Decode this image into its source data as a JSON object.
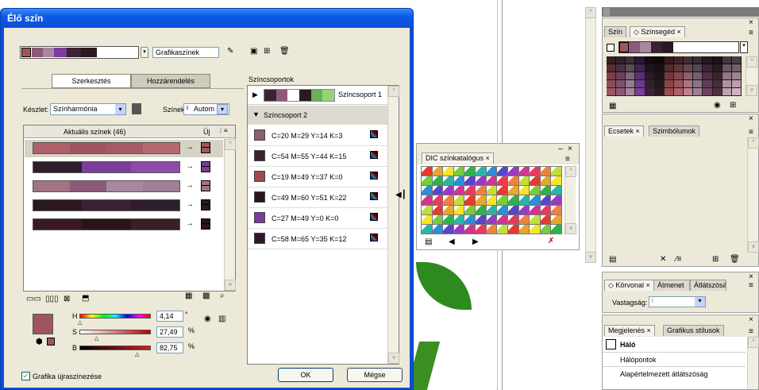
{
  "dialog": {
    "title": "Élő szín",
    "library_select": "Grafikaszínek",
    "tabs": [
      "Szerkesztés",
      "Hozzárendelés"
    ],
    "preset_label": "Készlet:",
    "preset_value": "Színharmónia",
    "colors_label": "Színek:",
    "colors_value": "Autom",
    "current_colors_header": "Aktuális színek (46)",
    "new_header": "Új",
    "color_groups_label": "Színcsoportok",
    "group1": "Színcsoport 1",
    "group2": "Színcsoport 2",
    "group2_colors": [
      {
        "label": "C=20 M=29 Y=14 K=3",
        "color": "#8b5f73"
      },
      {
        "label": "C=54 M=55 Y=44 K=15",
        "color": "#3a2233"
      },
      {
        "label": "C=19 M=49 Y=37 K=0",
        "color": "#9b4c52"
      },
      {
        "label": "C=49 M=60 Y=51 K=22",
        "color": "#2b1519"
      },
      {
        "label": "C=27 M=49 Y=0 K=0",
        "color": "#7a3e9a"
      },
      {
        "label": "C=58 M=65 Y=35 K=12",
        "color": "#2c1a2c"
      }
    ],
    "current_rows": [
      {
        "colors": [
          "#b06069",
          "#a0555e",
          "#a65a63",
          "#b46a70"
        ],
        "new": "#a0555e"
      },
      {
        "colors": [
          "#2e1c2c",
          "#7a3e9a",
          "#8d4ca8"
        ],
        "new": "#7a3e9a"
      },
      {
        "colors": [
          "#a27384",
          "#8c5a78",
          "#a887a0",
          "#9e7e95"
        ],
        "new": "#a27384"
      },
      {
        "colors": [
          "#2a1920",
          "#3a2233",
          "#2f1f2b"
        ],
        "new": "#2a1920"
      },
      {
        "colors": [
          "#3a1a20",
          "#2a1419",
          "#3a2025"
        ],
        "new": "#2a1419"
      }
    ],
    "hsb": {
      "h_label": "H",
      "s_label": "S",
      "b_label": "B",
      "h_value": "4,14",
      "s_value": "27,49",
      "b_value": "82,75",
      "h_unit": "°",
      "s_unit": "%",
      "b_unit": "%"
    },
    "recolor_checkbox": "Grafika újraszínezése",
    "ok": "OK",
    "cancel": "Mégse"
  },
  "dic_panel": {
    "title": "DIC színkatalógus"
  },
  "right_panels": {
    "color_tab": "Szín",
    "color_guide_tab": "Színsegéd",
    "brushes_tab": "Ecsetek",
    "symbols_tab": "Szimbólumok",
    "stroke_tab": "Körvonal",
    "gradient_tab": "Átmenet",
    "transparency_tab": "Átlátszóság",
    "weight_label": "Vastagság:",
    "appearance_tab": "Megjelenés",
    "graphic_styles_tab": "Grafikus stílusok",
    "appearance_items": [
      "Háló",
      "Hálópontok",
      "Alapértelmezett átlátszóság"
    ]
  },
  "colors": {
    "title_blue": "#0a5ae6",
    "dialog_bg": "#ece9d8"
  }
}
